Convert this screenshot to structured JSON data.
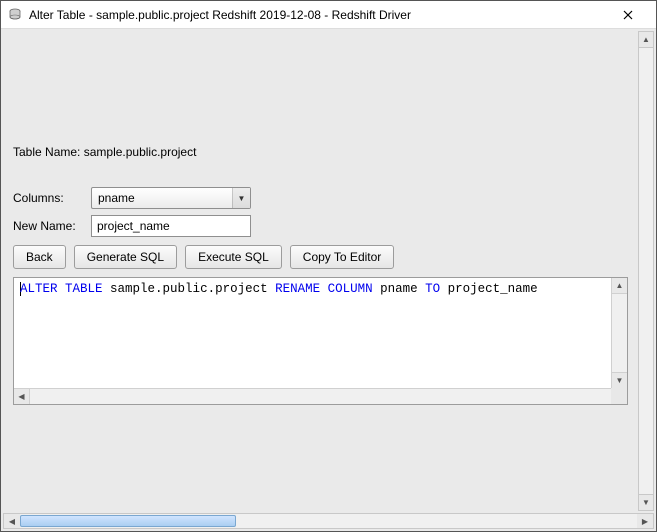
{
  "window": {
    "title": "Alter Table - sample.public.project Redshift 2019-12-08 - Redshift Driver"
  },
  "labels": {
    "table_name_prefix": "Table Name:",
    "table_name_value": "sample.public.project",
    "columns": "Columns:",
    "new_name": "New Name:"
  },
  "form": {
    "column_selected": "pname",
    "new_name_value": "project_name"
  },
  "buttons": {
    "back": "Back",
    "generate_sql": "Generate SQL",
    "execute_sql": "Execute SQL",
    "copy_to_editor": "Copy To Editor"
  },
  "sql": {
    "tokens": [
      {
        "t": "ALTER",
        "kw": true
      },
      {
        "t": " "
      },
      {
        "t": "TABLE",
        "kw": true
      },
      {
        "t": " sample.public.project "
      },
      {
        "t": "RENAME",
        "kw": true
      },
      {
        "t": " "
      },
      {
        "t": "COLUMN",
        "kw": true
      },
      {
        "t": " pname "
      },
      {
        "t": "TO",
        "kw": true
      },
      {
        "t": " project_name"
      }
    ]
  }
}
